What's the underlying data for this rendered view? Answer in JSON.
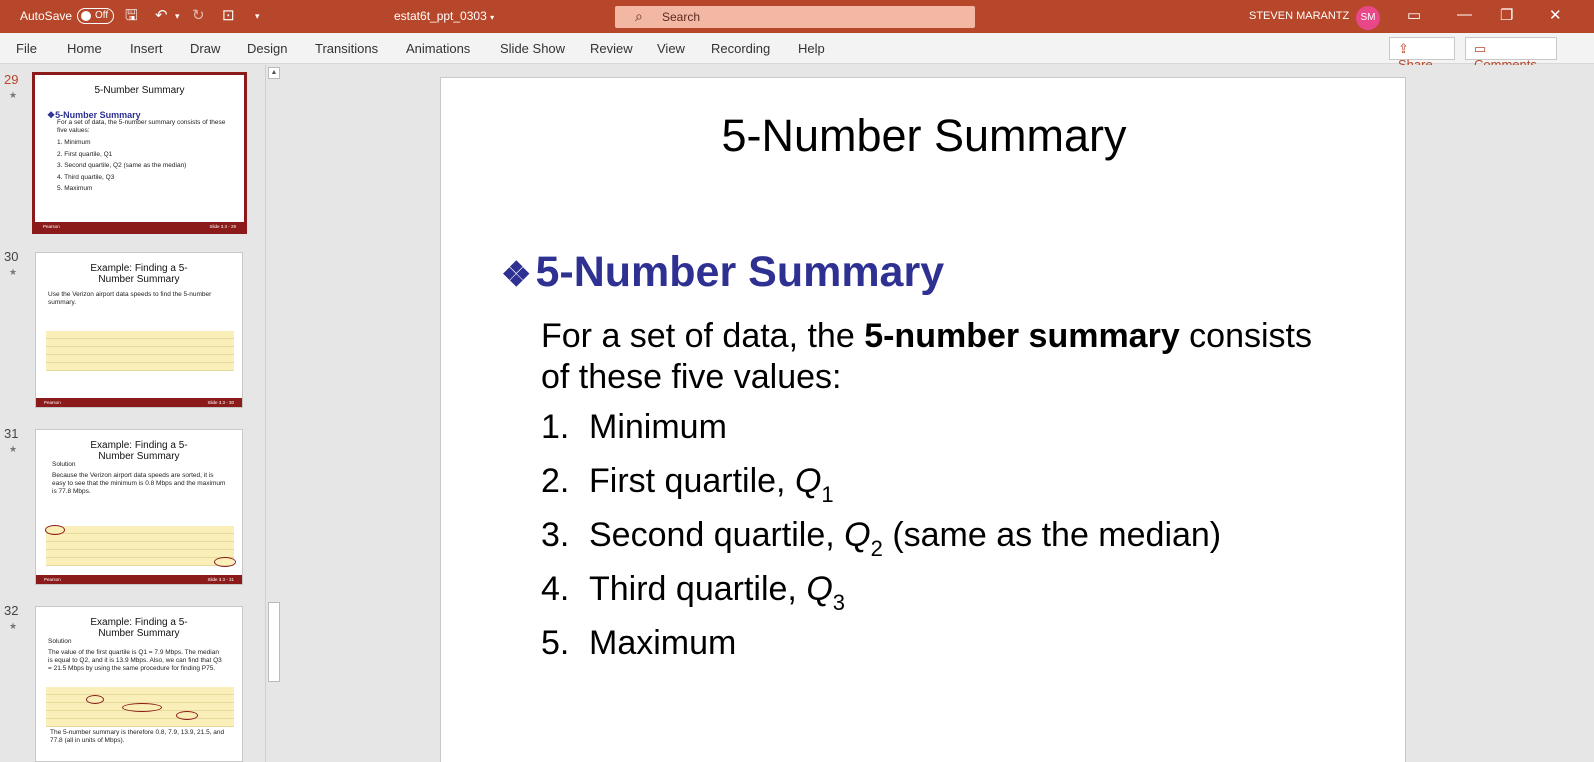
{
  "titlebar": {
    "autosave_label": "AutoSave",
    "autosave_state": "Off",
    "filename": "estat6t_ppt_0303",
    "search_placeholder": "Search",
    "user_name": "STEVEN MARANTZ",
    "user_initials": "SM"
  },
  "ribbon": {
    "tabs": [
      "File",
      "Home",
      "Insert",
      "Draw",
      "Design",
      "Transitions",
      "Animations",
      "Slide Show",
      "Review",
      "View",
      "Recording",
      "Help"
    ],
    "share_label": "Share",
    "comments_label": "Comments"
  },
  "thumbnails": [
    {
      "number": "29",
      "title": "5-Number Summary",
      "heading": "5-Number Summary",
      "intro": "For a set of data, the 5-number summary consists of these five values:",
      "items": [
        "1.  Minimum",
        "2.  First quartile, Q1",
        "3.  Second quartile, Q2 (same as the median)",
        "4.  Third quartile, Q3",
        "5.  Maximum"
      ],
      "footer_left": "Pearson",
      "footer_right": "Slide 3.3 - 29"
    },
    {
      "number": "30",
      "title": "Example: Finding a 5-Number Summary",
      "text": "Use the Verizon airport data speeds to find the 5-number summary.",
      "footer_left": "Pearson",
      "footer_right": "Slide 3.3 - 30"
    },
    {
      "number": "31",
      "title": "Example: Finding a 5-Number Summary",
      "label": "Solution",
      "text": "Because the Verizon airport data speeds are sorted, it is easy to see that the minimum is 0.8 Mbps and the maximum is 77.8 Mbps.",
      "footer_left": "Pearson",
      "footer_right": "Slide 3.3 - 31"
    },
    {
      "number": "32",
      "title": "Example: Finding a 5-Number Summary",
      "label": "Solution",
      "text": "The value of the first quartile is Q1 = 7.9 Mbps. The median is equal to Q2, and it is 13.9 Mbps. Also, we can find that Q3 = 21.5 Mbps by using the same procedure for finding P75.",
      "text2": "The 5-number summary is therefore 0.8, 7.9, 13.9, 21.5, and 77.8 (all in units of Mbps)."
    }
  ],
  "slide": {
    "title": "5-Number Summary",
    "bullet_symbol": "❖",
    "bullet_heading": "5-Number Summary",
    "intro_before": "For a set of data, the ",
    "intro_bold": "5-number summary",
    "intro_after": " consists of these five values:",
    "items": [
      {
        "num": "1.",
        "text": "Minimum",
        "q": "",
        "sub": "",
        "after": ""
      },
      {
        "num": "2.",
        "text": "First quartile, ",
        "q": "Q",
        "sub": "1",
        "after": ""
      },
      {
        "num": "3.",
        "text": "Second quartile, ",
        "q": "Q",
        "sub": "2",
        "after": " (same as the median)"
      },
      {
        "num": "4.",
        "text": "Third quartile, ",
        "q": "Q",
        "sub": "3",
        "after": ""
      },
      {
        "num": "5.",
        "text": "Maximum",
        "q": "",
        "sub": "",
        "after": ""
      }
    ]
  }
}
